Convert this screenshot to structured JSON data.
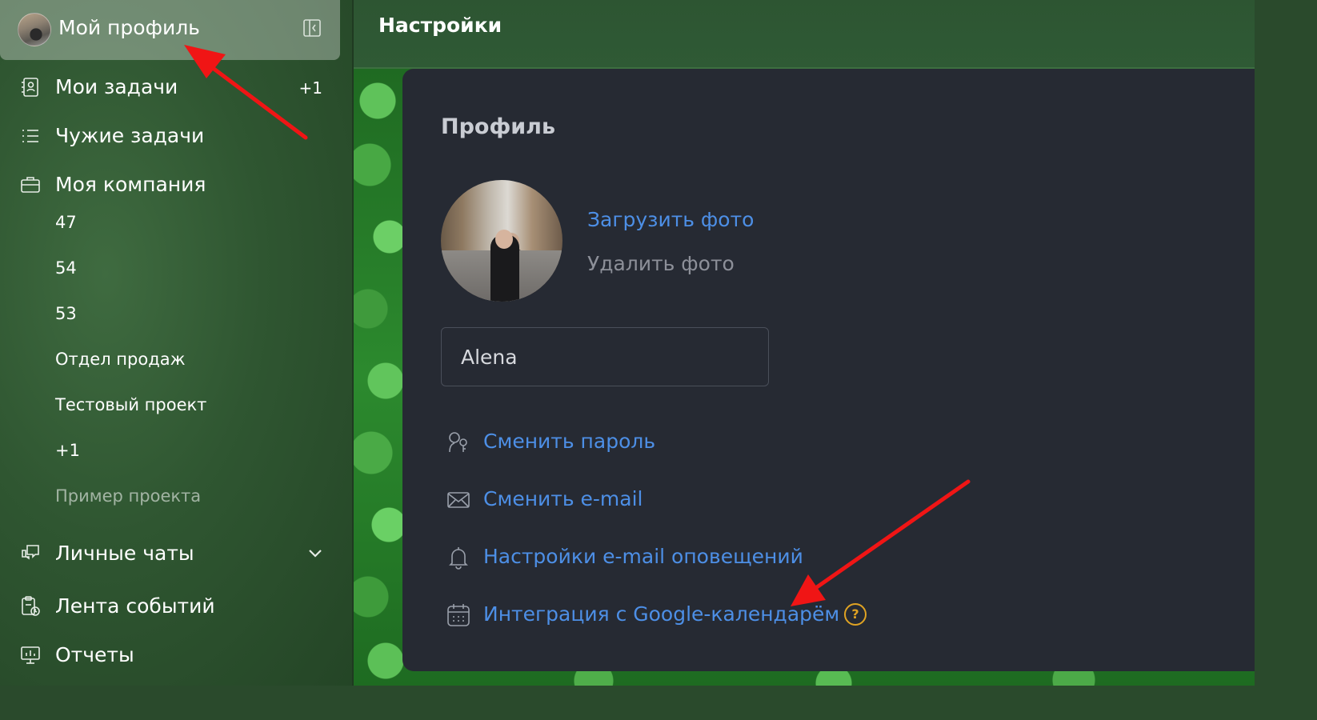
{
  "sidebar": {
    "profile_label": "Мой профиль",
    "items": [
      {
        "label": "Мои задачи",
        "icon": "task-contact-icon",
        "badge": "+1"
      },
      {
        "label": "Чужие задачи",
        "icon": "list-icon"
      },
      {
        "label": "Моя компания",
        "icon": "briefcase-icon"
      }
    ],
    "company_projects": [
      "47",
      "54",
      "53",
      "Отдел продаж",
      "Тестовый проект",
      "+1",
      "Пример проекта"
    ],
    "bottom_items": [
      {
        "label": "Личные чаты",
        "icon": "chat-icon"
      },
      {
        "label": "Лента событий",
        "icon": "clipboard-clock-icon"
      },
      {
        "label": "Отчеты",
        "icon": "monitor-chart-icon"
      }
    ]
  },
  "header": {
    "title": "Настройки"
  },
  "profile": {
    "section_title": "Профиль",
    "upload_photo": "Загрузить фото",
    "delete_photo": "Удалить фото",
    "name_value": "Alena",
    "actions": [
      {
        "label": "Сменить пароль",
        "icon": "key-person-icon"
      },
      {
        "label": "Сменить e-mail",
        "icon": "envelope-icon"
      },
      {
        "label": "Настройки e-mail оповещений",
        "icon": "bell-icon"
      },
      {
        "label": "Интеграция с Google-календарём",
        "icon": "calendar-icon"
      }
    ],
    "help_glyph": "?"
  },
  "colors": {
    "link": "#4d8fe6",
    "panel": "#262a33",
    "help": "#e0a323",
    "annotation": "#f01515"
  }
}
